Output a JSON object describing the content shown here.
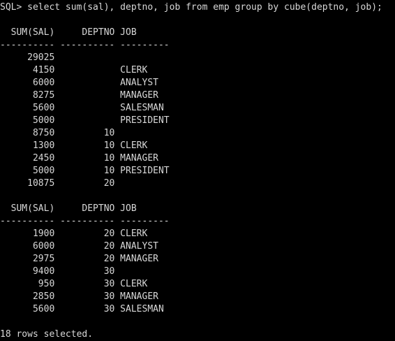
{
  "terminal": {
    "prompt": "SQL> select sum(sal), deptno, job from emp group by cube(deptno, job);",
    "block1": {
      "header": "  SUM(SAL)     DEPTNO JOB",
      "separator": "---------- ---------- ---------",
      "rows": [
        "     29025",
        "      4150            CLERK",
        "      6000            ANALYST",
        "      8275            MANAGER",
        "      5600            SALESMAN",
        "      5000            PRESIDENT",
        "      8750         10",
        "      1300         10 CLERK",
        "      2450         10 MANAGER",
        "      5000         10 PRESIDENT",
        "     10875         20"
      ]
    },
    "block2": {
      "header": "  SUM(SAL)     DEPTNO JOB",
      "separator": "---------- ---------- ---------",
      "rows": [
        "      1900         20 CLERK",
        "      6000         20 ANALYST",
        "      2975         20 MANAGER",
        "      9400         30",
        "       950         30 CLERK",
        "      2850         30 MANAGER",
        "      5600         30 SALESMAN"
      ]
    },
    "footer": "18 rows selected."
  }
}
